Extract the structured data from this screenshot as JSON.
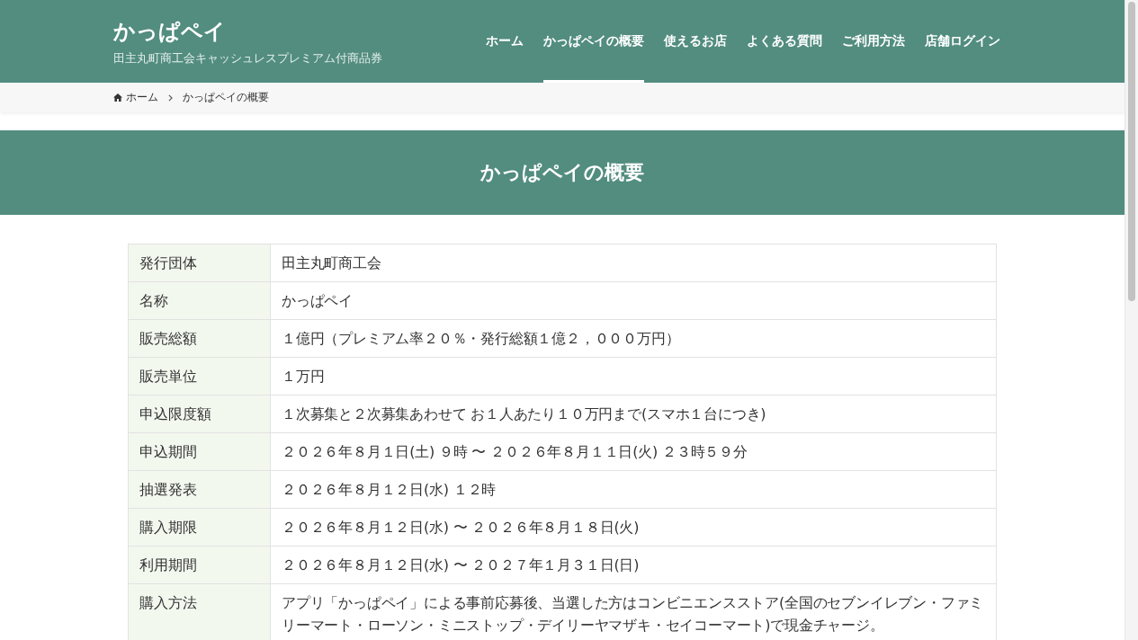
{
  "site": {
    "title": "かっぱペイ",
    "tagline": "田主丸町商工会キャッシュレスプレミアム付商品券"
  },
  "nav": [
    {
      "label": "ホーム",
      "selected": false
    },
    {
      "label": "かっぱペイの概要",
      "selected": true
    },
    {
      "label": "使えるお店",
      "selected": false
    },
    {
      "label": "よくある質問",
      "selected": false
    },
    {
      "label": "ご利用方法",
      "selected": false
    },
    {
      "label": "店舗ログイン",
      "selected": false
    }
  ],
  "breadcrumb": [
    {
      "label": "ホーム",
      "kind": "home"
    },
    {
      "label": "かっぱペイの概要",
      "kind": "current"
    }
  ],
  "page_title": "かっぱペイの概要",
  "table": {
    "rows": [
      {
        "label": "発行団体",
        "value": "田主丸町商工会"
      },
      {
        "label": "名称",
        "value": "かっぱペイ"
      },
      {
        "label": "販売総額",
        "value": "１億円（プレミアム率２０％・発行総額１億２，０００万円）"
      },
      {
        "label": "販売単位",
        "value": "１万円"
      },
      {
        "label": "申込限度額",
        "value": "１次募集と２次募集あわせて お１人あたり１０万円まで(スマホ１台につき)"
      },
      {
        "label": "申込期間",
        "value": "２０２６年８月１日(土) ９時 〜 ２０２６年８月１１日(火) ２３時５９分"
      },
      {
        "label": "抽選発表",
        "value": "２０２６年８月１２日(水) １２時"
      },
      {
        "label": "購入期限",
        "value": "２０２６年８月１２日(水) 〜 ２０２６年８月１８日(火)"
      },
      {
        "label": "利用期間",
        "value": "２０２６年８月１２日(水) 〜 ２０２７年１月３１日(日)"
      },
      {
        "label": "購入方法",
        "value": "アプリ「かっぱペイ」による事前応募後、当選した方はコンビニエンスストア(全国のセブンイレブン・ファミリーマート・ローソン・ミニストップ・デイリーヤマザキ・セイコーマート)で現金チャージ。"
      }
    ]
  }
}
